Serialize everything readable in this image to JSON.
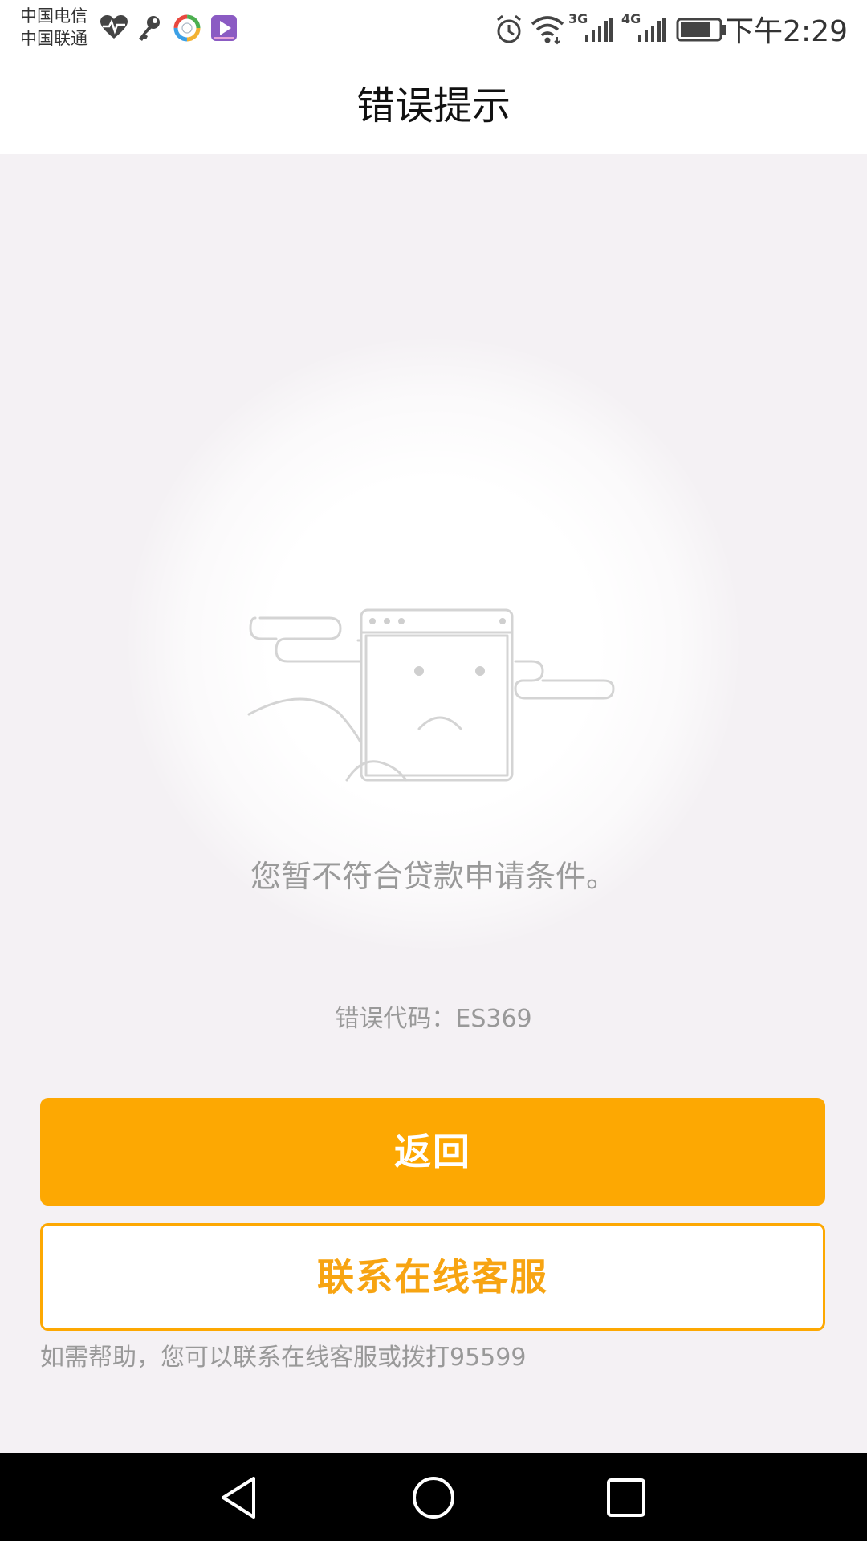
{
  "status_bar": {
    "carrier_1": "中国电信",
    "carrier_2": "中国联通",
    "network_1": "3G",
    "network_2": "4G",
    "time": "下午2:29",
    "icons": [
      "heart-pulse-icon",
      "key-icon",
      "colorful-app-icon",
      "video-app-icon",
      "alarm-icon",
      "wifi-icon",
      "signal-3g-icon",
      "signal-4g-icon",
      "battery-icon"
    ]
  },
  "header": {
    "title": "错误提示"
  },
  "main": {
    "illustration": "sad-browser-window-icon",
    "message": "您暂不符合贷款申请条件。",
    "error_code": "错误代码：ES369"
  },
  "actions": {
    "back_label": "返回",
    "contact_label": "联系在线客服"
  },
  "help": {
    "text": "如需帮助，您可以联系在线客服或拨打95599"
  },
  "nav": {
    "icons": [
      "back-triangle-icon",
      "home-circle-icon",
      "recent-square-icon"
    ]
  },
  "colors": {
    "accent": "#fda802",
    "background": "#f4f1f4",
    "text_muted": "#999999"
  }
}
